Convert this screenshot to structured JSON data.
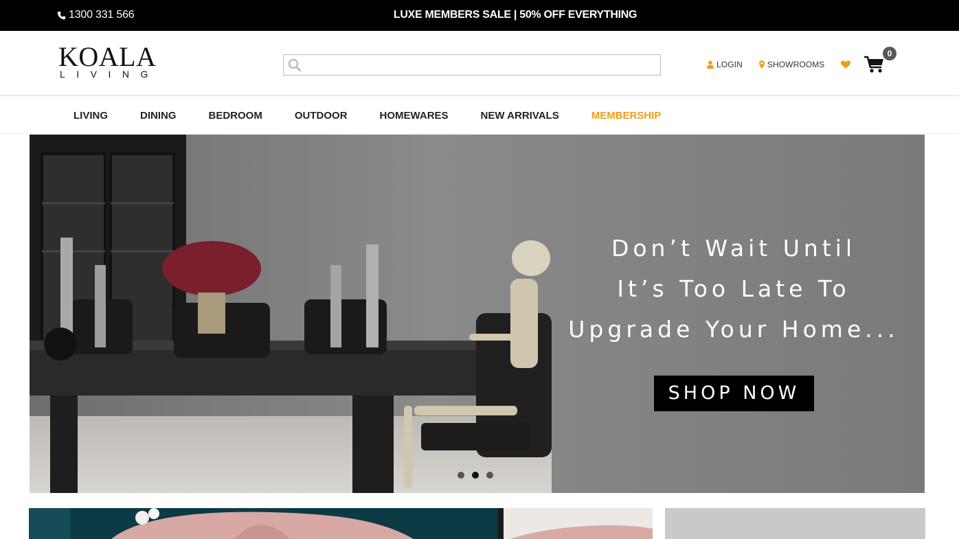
{
  "topbar": {
    "phone": "1300 331 566",
    "promo": "LUXE MEMBERS SALE | 50% OFF EVERYTHING"
  },
  "header": {
    "logo_brand": "KOALA",
    "logo_sub": "LIVING",
    "search": {
      "placeholder": "",
      "value": ""
    },
    "links": {
      "login": "LOGIN",
      "showrooms": "SHOWROOMS"
    },
    "cart_count": "0"
  },
  "nav": {
    "items": [
      {
        "label": "LIVING"
      },
      {
        "label": "DINING"
      },
      {
        "label": "BEDROOM"
      },
      {
        "label": "OUTDOOR"
      },
      {
        "label": "HOMEWARES"
      },
      {
        "label": "NEW ARRIVALS"
      },
      {
        "label": "MEMBERSHIP"
      }
    ]
  },
  "hero": {
    "headline_line1": "Don’t Wait Until",
    "headline_line2": "It’s Too Late To",
    "headline_line3": "Upgrade Your Home...",
    "cta_label": "SHOP NOW",
    "slide_count": 3,
    "active_slide": 2
  },
  "colors": {
    "accent": "#f39c12",
    "topbar_bg": "#000000",
    "hero_bg": "#7a7a7a"
  },
  "icons": {
    "phone": "phone-icon",
    "search": "search-icon",
    "login": "user-icon",
    "showrooms": "map-marker-icon",
    "wishlist": "heart-icon",
    "cart": "shopping-cart-icon"
  }
}
